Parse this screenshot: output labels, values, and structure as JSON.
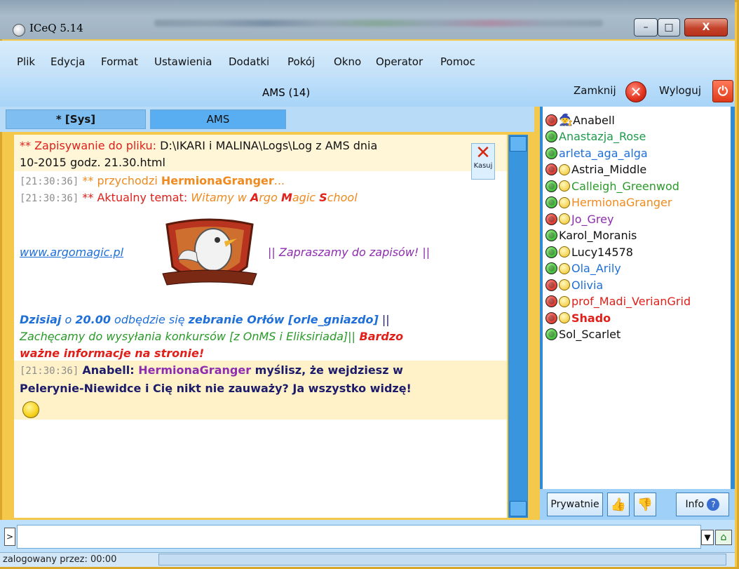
{
  "window": {
    "title": "ICeQ 5.14",
    "min_label": "–",
    "max_label": "□",
    "close_label": "X"
  },
  "menu": [
    "Plik",
    "Edycja",
    "Format",
    "Ustawienia",
    "Dodatki",
    "Pokój",
    "Okno",
    "Operator",
    "Pomoc"
  ],
  "room": {
    "title": "AMS (14)",
    "close_label": "Zamknij",
    "logout_label": "Wyloguj"
  },
  "tabs": {
    "sys": "* [Sys]",
    "ams": "AMS"
  },
  "chat": {
    "save_prefix": "** Zapisywanie do pliku: ",
    "save_path_1": "D:\\IKARI i MALINA\\Logs\\Log z AMS dnia",
    "save_path_2": "10-2015 godz. 21.30.html",
    "kasuj": "Kasuj",
    "l1_ts": "[21:30:36]",
    "l1_a": " ** przychodzi ",
    "l1_name": "HermionaGranger",
    "l1_b": "...",
    "l2_ts": "[21:30:36]",
    "l2_a": " ** Aktualny temat: ",
    "l2_b1": "Witamy w ",
    "l2_A": "A",
    "l2_b2": "rgo ",
    "l2_M": "M",
    "l2_b3": "agic ",
    "l2_S": "S",
    "l2_b4": "chool",
    "link": "www.argomagic.pl",
    "invite": "|| Zapraszamy do zapisów! ||",
    "a1_day": "Dzisiaj",
    "a1_o": " o ",
    "a1_time": "20.00",
    "a1_mid": " odbędzie się ",
    "a1_event": "zebranie Orłów [orle_gniazdo]",
    "a1_end": " ||",
    "a2": "Zachęcamy do wysyłania konkursów [z OnMS i Eliksiriada]||",
    "a2_bold": " Bardzo",
    "a3": "ważne informacje na stronie!",
    "m_ts": "[21:30:36]",
    "m_user": "Anabell",
    "m_colon": ": ",
    "m_target": "HermionaGranger",
    "m_text1": " myślisz, że wejdziesz w",
    "m_text2": "Pelerynie-Niewidce i Cię nikt nie zauważy? Ja wszystko widzę!"
  },
  "users": [
    {
      "name": "Anabell",
      "status": "red",
      "icon": "wizard-icon",
      "color": "#111111",
      "bold": false
    },
    {
      "name": "Anastazja_Rose",
      "status": "green",
      "icon": "",
      "color": "#1e9a4a",
      "bold": false
    },
    {
      "name": "arleta_aga_alga",
      "status": "green",
      "icon": "",
      "color": "#1e6fd8",
      "bold": false
    },
    {
      "name": "Astria_Middle",
      "status": "red",
      "icon": "mood-icon",
      "color": "#111111",
      "bold": false
    },
    {
      "name": "Calleigh_Greenwod",
      "status": "green",
      "icon": "mood-icon",
      "color": "#2a9a2a",
      "bold": false
    },
    {
      "name": "HermionaGranger",
      "status": "green",
      "icon": "mood-icon",
      "color": "#f08a1e",
      "bold": false
    },
    {
      "name": "Jo_Grey",
      "status": "red",
      "icon": "mood-icon",
      "color": "#8e2db0",
      "bold": false
    },
    {
      "name": "Karol_Moranis",
      "status": "green",
      "icon": "",
      "color": "#111111",
      "bold": false
    },
    {
      "name": "Lucy14578",
      "status": "green",
      "icon": "mood-icon",
      "color": "#111111",
      "bold": false
    },
    {
      "name": "Ola_Arily",
      "status": "green",
      "icon": "mood-icon",
      "color": "#1e6fd8",
      "bold": false
    },
    {
      "name": "Olivia",
      "status": "red",
      "icon": "mood-icon",
      "color": "#1e6fd8",
      "bold": false
    },
    {
      "name": "prof_Madi_VerianGrid",
      "status": "red",
      "icon": "mood-icon",
      "color": "#e0201a",
      "bold": false
    },
    {
      "name": "Shado",
      "status": "red",
      "icon": "mood-icon",
      "color": "#e0201a",
      "bold": true
    },
    {
      "name": "Sol_Scarlet",
      "status": "green",
      "icon": "",
      "color": "#111111",
      "bold": false
    }
  ],
  "panel": {
    "private": "Prywatnie",
    "info": "Info"
  },
  "input": {
    "value": "",
    "prompt": ">"
  },
  "status": {
    "text": "zalogowany przez: 00:00"
  }
}
